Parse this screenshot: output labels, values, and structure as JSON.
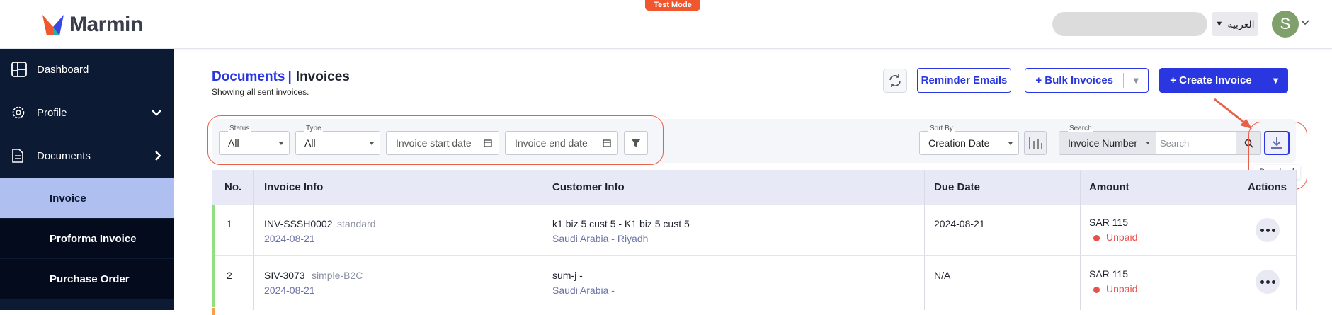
{
  "app": {
    "logo_text": "Marmin",
    "test_mode_label": "Test Mode"
  },
  "header": {
    "language_label": "العربية",
    "avatar_initial": "S"
  },
  "sidebar": {
    "items": [
      {
        "label": "Dashboard",
        "icon": "dashboard-icon"
      },
      {
        "label": "Profile",
        "icon": "gear-icon"
      },
      {
        "label": "Documents",
        "icon": "document-icon"
      }
    ],
    "sub_items": [
      {
        "label": "Invoice",
        "active": true
      },
      {
        "label": "Proforma Invoice",
        "active": false
      },
      {
        "label": "Purchase Order",
        "active": false
      }
    ]
  },
  "page": {
    "breadcrumb": "Documents",
    "separator": "|",
    "title": "Invoices",
    "subtitle": "Showing all sent invoices."
  },
  "toolbar": {
    "reminder_label": "Reminder Emails",
    "bulk_label": "+ Bulk Invoices",
    "create_label": "+ Create Invoice"
  },
  "filters": {
    "status_label": "Status",
    "status_value": "All",
    "type_label": "Type",
    "type_value": "All",
    "start_date_placeholder": "Invoice start date",
    "end_date_placeholder": "Invoice end date",
    "sort_label": "Sort By",
    "sort_value": "Creation Date",
    "search_label": "Search",
    "search_type": "Invoice Number",
    "search_placeholder": "Search",
    "download_tooltip": "Download"
  },
  "table": {
    "headers": [
      "No.",
      "Invoice Info",
      "Customer Info",
      "Due Date",
      "Amount",
      "Actions"
    ],
    "rows": [
      {
        "no": "1",
        "invoice_number": "INV-SSSH0002",
        "invoice_type": "standard",
        "invoice_date": "2024-08-21",
        "customer_name": "k1 biz 5 cust 5 - K1 biz 5 cust 5",
        "customer_location": "Saudi Arabia - Riyadh",
        "due_date": "2024-08-21",
        "amount": "SAR 115",
        "status": "Unpaid"
      },
      {
        "no": "2",
        "invoice_number": "SIV-3073",
        "invoice_type": "simple-B2C",
        "invoice_date": "2024-08-21",
        "customer_name": "sum-j -",
        "customer_location": "Saudi Arabia -",
        "due_date": "N/A",
        "amount": "SAR 115",
        "status": "Unpaid"
      }
    ]
  },
  "colors": {
    "primary": "#2a36e0",
    "sidebar": "#0c1a33",
    "sidebar_active": "#aebff0",
    "unpaid": "#e5514d",
    "row_indicator": "#8fe07f",
    "annotation": "#e8604a"
  }
}
